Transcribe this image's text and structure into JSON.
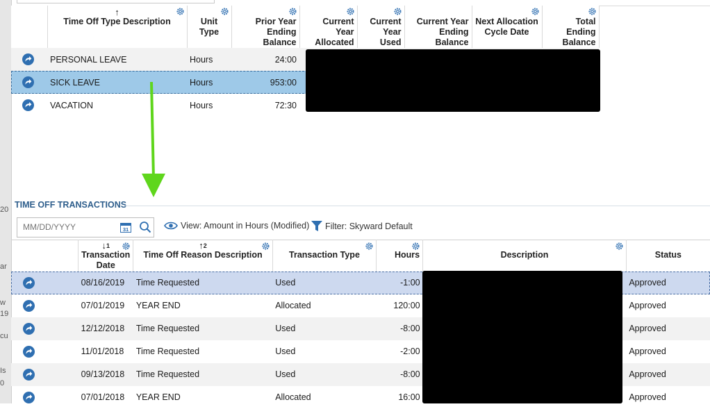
{
  "edge_fragments": [
    "20",
    "ar",
    "w",
    "19",
    "cu",
    "Is",
    "0"
  ],
  "top_table": {
    "columns": [
      {
        "label": "",
        "sort": ""
      },
      {
        "label": "Time Off Type Description",
        "sort": "↑"
      },
      {
        "label": "Unit Type",
        "sort": ""
      },
      {
        "label": "Prior Year Ending Balance",
        "sort": ""
      },
      {
        "label": "Current Year Allocated",
        "sort": ""
      },
      {
        "label": "Current Year Used",
        "sort": ""
      },
      {
        "label": "Current Year Ending Balance",
        "sort": ""
      },
      {
        "label": "Next Allocation Cycle Date",
        "sort": ""
      },
      {
        "label": "Total Ending Balance",
        "sort": ""
      }
    ],
    "rows": [
      {
        "type": "PERSONAL LEAVE",
        "unit": "Hours",
        "prior": "24:00"
      },
      {
        "type": "SICK LEAVE",
        "unit": "Hours",
        "prior": "953:00"
      },
      {
        "type": "VACATION",
        "unit": "Hours",
        "prior": "72:30"
      }
    ]
  },
  "transactions": {
    "section_title": "TIME OFF TRANSACTIONS",
    "date_placeholder": "MM/DD/YYYY",
    "calendar_label": "31",
    "view_label": "View: Amount in Hours (Modified)",
    "filter_label": "Filter: Skyward Default",
    "columns": {
      "date": {
        "label": "Transaction Date",
        "sort": "↓",
        "sort_num": "1"
      },
      "reason": {
        "label": "Time Off Reason Description",
        "sort": "↑",
        "sort_num": "2"
      },
      "ttype": {
        "label": "Transaction Type"
      },
      "hours": {
        "label": "Hours"
      },
      "desc": {
        "label": "Description"
      },
      "status": {
        "label": "Status"
      }
    },
    "rows": [
      {
        "date": "08/16/2019",
        "reason": "Time Requested",
        "type": "Used",
        "hours": "-1:00",
        "status": "Approved"
      },
      {
        "date": "07/01/2019",
        "reason": "YEAR END",
        "type": "Allocated",
        "hours": "120:00",
        "status": "Approved"
      },
      {
        "date": "12/12/2018",
        "reason": "Time Requested",
        "type": "Used",
        "hours": "-8:00",
        "status": "Approved"
      },
      {
        "date": "11/01/2018",
        "reason": "Time Requested",
        "type": "Used",
        "hours": "-2:00",
        "status": "Approved"
      },
      {
        "date": "09/13/2018",
        "reason": "Time Requested",
        "type": "Used",
        "hours": "-8:00",
        "status": "Approved"
      },
      {
        "date": "07/01/2018",
        "reason": "YEAR END",
        "type": "Allocated",
        "hours": "16:00",
        "status": "Approved"
      }
    ]
  },
  "colors": {
    "accent": "#2e5e8c",
    "selected_row_top": "#9ec9e8",
    "selected_row_bottom": "#cdd9ef",
    "annotation_arrow": "#5fd61c",
    "redaction": "#000000"
  }
}
